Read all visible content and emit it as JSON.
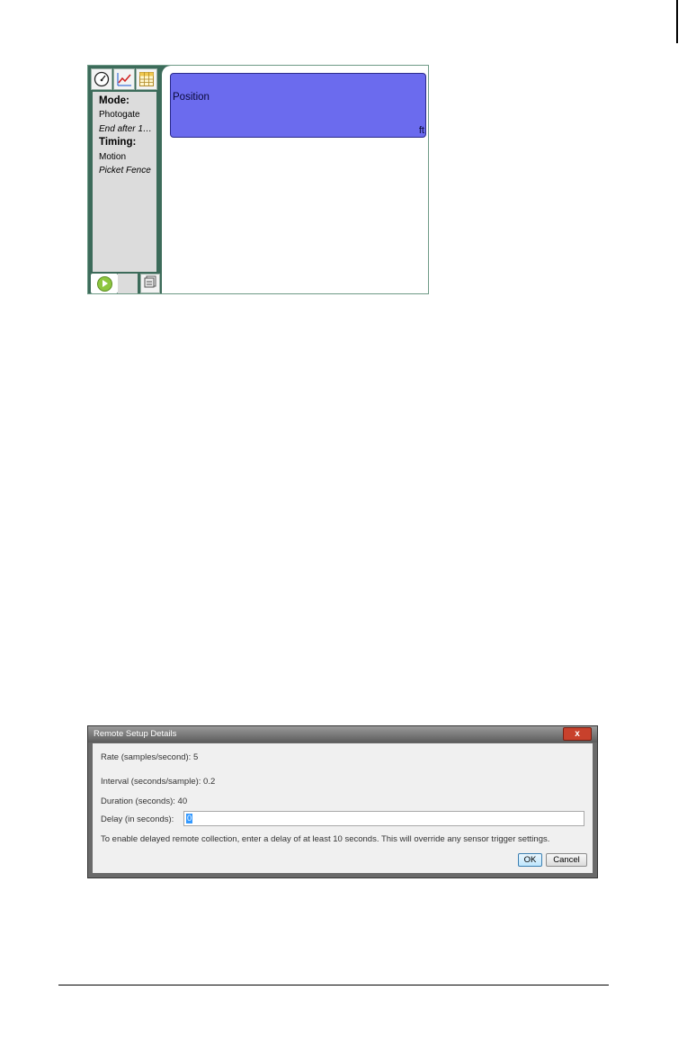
{
  "app": {
    "tabs": [
      "meter-icon",
      "graph-icon",
      "table-icon"
    ],
    "sidebar": {
      "mode_label": "Mode:",
      "mode_value": "Photogate",
      "mode_detail": "End after 1…",
      "timing_label": "Timing:",
      "timing_value": "Motion",
      "timing_detail": "Picket Fence"
    },
    "meter": {
      "label": "Position",
      "unit": "ft",
      "color": "#6b6bee"
    },
    "bottom_controls": [
      "play-icon",
      "store-data-icon"
    ]
  },
  "dialog": {
    "title": "Remote Setup Details",
    "close_label": "x",
    "rate": "Rate (samples/second): 5",
    "interval": "Interval (seconds/sample): 0.2",
    "duration": "Duration (seconds):  40",
    "delay_label": "Delay (in seconds):",
    "delay_value": "0",
    "hint": "To enable delayed remote collection, enter a delay of at least 10 seconds.  This will override any sensor trigger settings.",
    "ok_label": "OK",
    "cancel_label": "Cancel"
  }
}
